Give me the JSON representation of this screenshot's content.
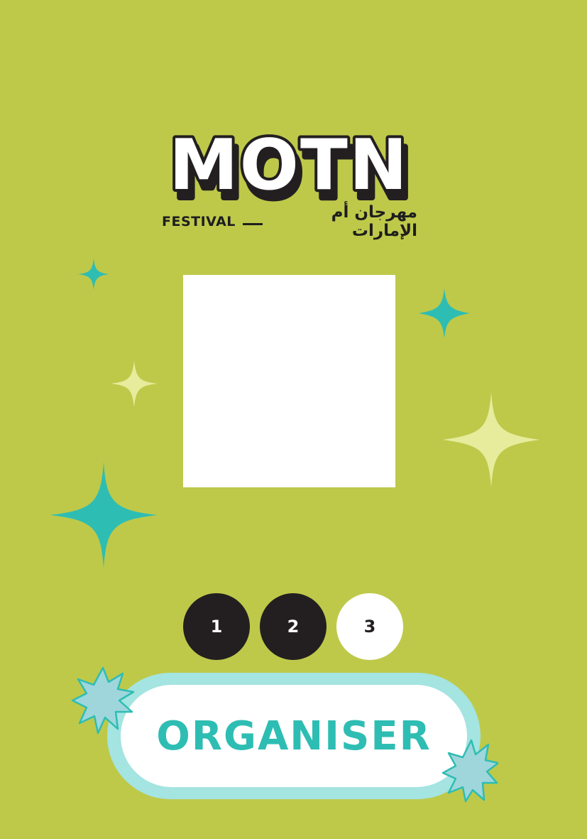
{
  "brand": {
    "logo_text": "MOTN",
    "tagline_en": "FESTIVAL",
    "tagline_ar": "مهرجان أم الإمارات"
  },
  "days": [
    {
      "label": "1",
      "state": "selected"
    },
    {
      "label": "2",
      "state": "selected"
    },
    {
      "label": "3",
      "state": "unselected"
    }
  ],
  "role": {
    "label": "ORGANISER"
  },
  "colors": {
    "background": "#bec94a",
    "sparkle_teal": "#2ebdb3",
    "sparkle_cream": "#e6ec9c",
    "dark": "#231f20",
    "pill_outline": "#a4e4e1",
    "role_text": "#2ebdb3",
    "badge_star": "#9fd6dc"
  }
}
